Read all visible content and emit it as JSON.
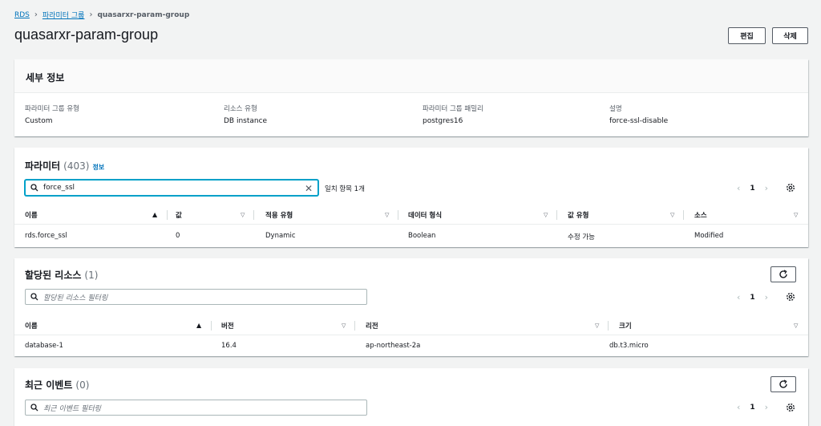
{
  "breadcrumb": {
    "items": [
      "RDS",
      "파라미터 그룹",
      "quasarxr-param-group"
    ],
    "separator": ">"
  },
  "page": {
    "title": "quasarxr-param-group",
    "edit_label": "편집",
    "delete_label": "삭제"
  },
  "details": {
    "title": "세부 정보",
    "fields": [
      {
        "label": "파라미터 그룹 유형",
        "value": "Custom"
      },
      {
        "label": "리소스 유형",
        "value": "DB instance"
      },
      {
        "label": "파라미터 그룹 패밀리",
        "value": "postgres16"
      },
      {
        "label": "설명",
        "value": "force-ssl-disable"
      }
    ]
  },
  "parameters": {
    "title": "파라미터",
    "count": "(403)",
    "info": "정보",
    "search_value": "force_ssl",
    "match_text": "일치 항목 1개",
    "page": "1",
    "columns": [
      "이름",
      "값",
      "적용 유형",
      "데이터 형식",
      "값 유형",
      "소스"
    ],
    "rows": [
      [
        "rds.force_ssl",
        "0",
        "Dynamic",
        "Boolean",
        "수정 가능",
        "Modified"
      ]
    ]
  },
  "resources": {
    "title": "할당된 리소스",
    "count": "(1)",
    "search_placeholder": "할당된 리소스 필터링",
    "page": "1",
    "columns": [
      "이름",
      "버전",
      "리전",
      "크기"
    ],
    "rows": [
      [
        "database-1",
        "16.4",
        "ap-northeast-2a",
        "db.t3.micro"
      ]
    ]
  },
  "events": {
    "title": "최근 이벤트",
    "count": "(0)",
    "search_placeholder": "최근 이벤트 필터링",
    "page": "1"
  },
  "icons": {
    "breadcrumb_separator": "chevron-right-icon",
    "search": "search-icon",
    "clear": "close-icon",
    "prev": "chevron-left-icon",
    "next": "chevron-right-icon",
    "settings": "gear-icon",
    "refresh": "refresh-icon",
    "sort_asc": "sort-ascending-icon",
    "sort": "sort-caret-icon"
  },
  "colors": {
    "link": "#0073bb",
    "focus": "#00a1c9",
    "border": "#aab7b8",
    "background": "#f2f3f3"
  }
}
